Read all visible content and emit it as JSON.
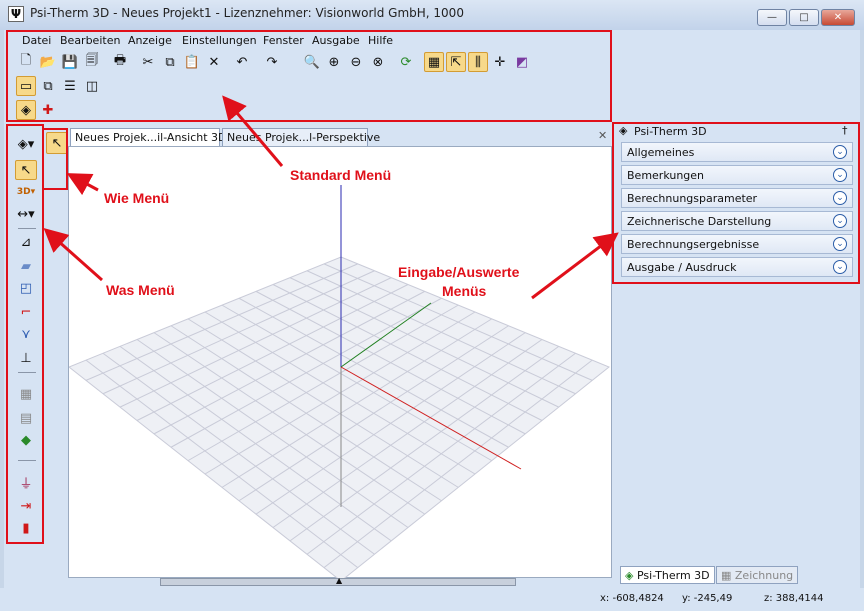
{
  "window": {
    "title": "Psi-Therm 3D - Neues Projekt1 - Lizenznehmer: Visionworld GmbH, 1000",
    "minimize": "—",
    "maximize": "□",
    "close": "✕"
  },
  "menubar": [
    "Datei",
    "Bearbeiten",
    "Anzeige",
    "Einstellungen",
    "Fenster",
    "Ausgabe",
    "Hilfe"
  ],
  "toolbar_icons": {
    "row1": [
      "new-file",
      "open-folder",
      "save",
      "save-all",
      "print",
      "cut",
      "copy",
      "paste",
      "delete",
      "undo",
      "redo",
      "zoom",
      "zoom-in",
      "zoom-out",
      "zoom-reset",
      "refresh",
      "grid",
      "select-grid",
      "columns",
      "snap",
      "corner"
    ],
    "row2": [
      "window-single",
      "window-cascade",
      "window-horizontal",
      "window-vertical"
    ],
    "row3": [
      "cube",
      "add-red"
    ]
  },
  "doc_tabs": [
    "Neues Projek...il-Ansicht 3D",
    "Neues Projek...l-Perspektive"
  ],
  "doc_tabs_close": "✕",
  "panel": {
    "title": "Psi-Therm 3D",
    "pin": "†",
    "sections": [
      "Allgemeines",
      "Bemerkungen",
      "Berechnungsparameter",
      "Zeichnerische Darstellung",
      "Berechnungsergebnisse",
      "Ausgabe / Ausdruck"
    ],
    "bottom_tabs": [
      "Psi-Therm 3D",
      "Zeichnung"
    ]
  },
  "annotations": {
    "standard": "Standard Menü",
    "wie": "Wie Menü",
    "was": "Was Menü",
    "eingabe_line1": "Eingabe/Auswerte",
    "eingabe_line2": "Menüs"
  },
  "status": {
    "x": "x: -608,4824",
    "y": "y: -245,49",
    "z": "z: 388,4144"
  },
  "colors": {
    "annotation": "#e0101a",
    "highlight": "#f7d98a",
    "axis_x": "#d02020",
    "axis_y": "#208020",
    "axis_z": "#2020c0"
  }
}
